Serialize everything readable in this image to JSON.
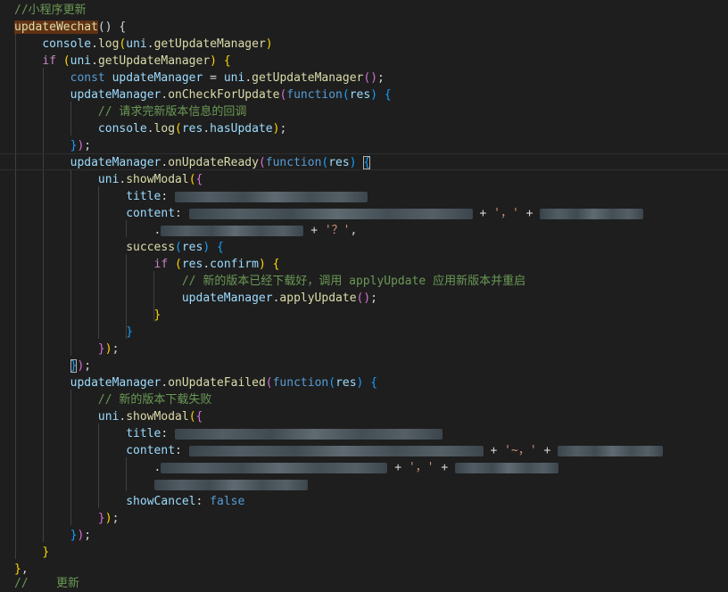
{
  "code": {
    "comment_header": "//小程序更新",
    "fn_name": "updateWechat",
    "l2_open": "() {",
    "console1": "console",
    "dot": ".",
    "log": "log",
    "uni": "uni",
    "getUpdateManager": "getUpdateManager",
    "if_kw": "if",
    "const_kw": "const",
    "updateManager": "updateManager",
    "eq": " = ",
    "onCheckForUpdate": "onCheckForUpdate",
    "function_kw": "function",
    "res": "res",
    "comment_check": "// 请求完新版本信息的回调",
    "hasUpdate": "hasUpdate",
    "close_paren_semi": "});",
    "onUpdateReady": "onUpdateReady",
    "showModal": "showModal",
    "title_key": "title",
    "content_key": "content",
    "str_comma": "'，'",
    "str_q": "'？'",
    "success": "success",
    "confirm": "confirm",
    "comment_apply": "// 新的版本已经下载好，调用 applyUpdate 应用新版本并重启",
    "applyUpdate": "applyUpdate",
    "onUpdateFailed": "onUpdateFailed",
    "comment_failed": "// 新的版本下载失败",
    "str_tilde": "'~，'",
    "str_comma2": "'，'",
    "showCancel": "showCancel",
    "false_kw": "false",
    "footer": "//    更新"
  }
}
